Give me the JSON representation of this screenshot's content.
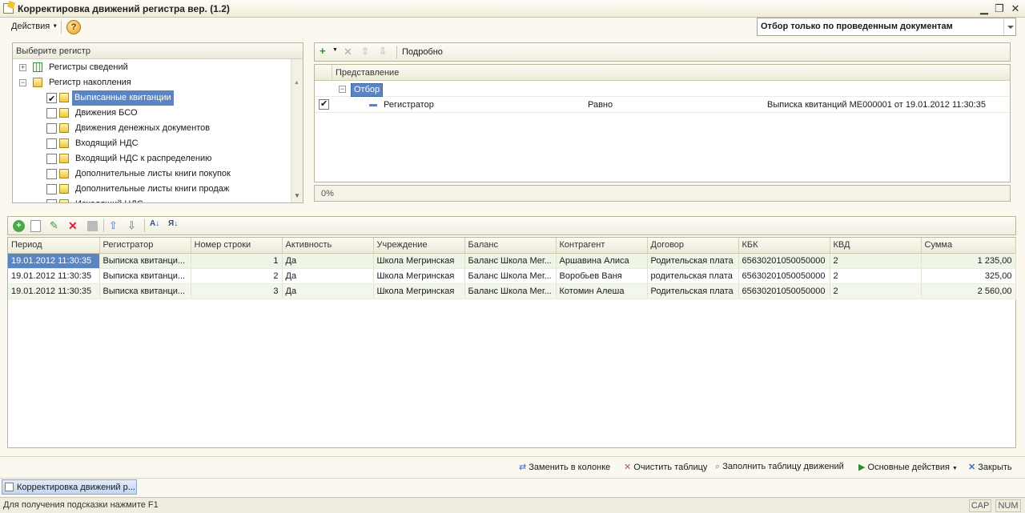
{
  "window": {
    "title": "Корректировка движений регистра вер. (1.2)"
  },
  "toolbar": {
    "actions_label": "Действия",
    "help_label": "?"
  },
  "filter_combo": {
    "value": "Отбор только по проведенным документам"
  },
  "register_tree": {
    "header": "Выберите регистр",
    "groups": [
      {
        "label": "Регистры сведений"
      },
      {
        "label": "Регистр накопления"
      }
    ],
    "items": [
      {
        "label": "Выписанные квитанции",
        "checked": true
      },
      {
        "label": "Движения БСО",
        "checked": false
      },
      {
        "label": "Движения денежных документов",
        "checked": false
      },
      {
        "label": "Входящий НДС",
        "checked": false
      },
      {
        "label": "Входящий НДС к распределению",
        "checked": false
      },
      {
        "label": "Дополнительные листы книги покупок",
        "checked": false
      },
      {
        "label": "Дополнительные листы книги продаж",
        "checked": false
      },
      {
        "label": "Исходящий НДС",
        "checked": false
      }
    ]
  },
  "filter_panel": {
    "details_label": "Подробно",
    "column_header": "Представление",
    "group_label": "Отбор",
    "row": {
      "field": "Регистратор",
      "condition": "Равно",
      "value": "Выписка квитанций МЕ000001 от 19.01.2012 11:30:35"
    },
    "progress": "0%"
  },
  "movements_table": {
    "columns": [
      "Период",
      "Регистратор",
      "Номер строки",
      "Активность",
      "Учреждение",
      "Баланс",
      "Контрагент",
      "Договор",
      "КБК",
      "КВД",
      "Сумма"
    ],
    "rows": [
      [
        "19.01.2012 11:30:35",
        "Выписка квитанци...",
        "1",
        "Да",
        "Школа Мегринская",
        "Баланс Школа Мег...",
        "Аршавина Алиса",
        "Родительская плата",
        "65630201050050000",
        "2",
        "1 235,00"
      ],
      [
        "19.01.2012 11:30:35",
        "Выписка квитанци...",
        "2",
        "Да",
        "Школа Мегринская",
        "Баланс Школа Мег...",
        "Воробьев Ваня",
        "родительская плата",
        "65630201050050000",
        "2",
        "325,00"
      ],
      [
        "19.01.2012 11:30:35",
        "Выписка квитанци...",
        "3",
        "Да",
        "Школа Мегринская",
        "Баланс Школа Мег...",
        "Котомин Алеша",
        "Родительская плата",
        "65630201050050000",
        "2",
        "2 560,00"
      ]
    ]
  },
  "bottom_actions": {
    "replace_in_column": "Заменить в колонке",
    "clear_table": "Очистить таблицу",
    "fill_table": "Заполнить таблицу движений",
    "main_actions": "Основные действия",
    "close": "Закрыть"
  },
  "taskbar": {
    "tab_label": "Корректировка движений р..."
  },
  "statusbar": {
    "hint": "Для получения подсказки нажмите F1",
    "cap": "CAP",
    "num": "NUM"
  }
}
